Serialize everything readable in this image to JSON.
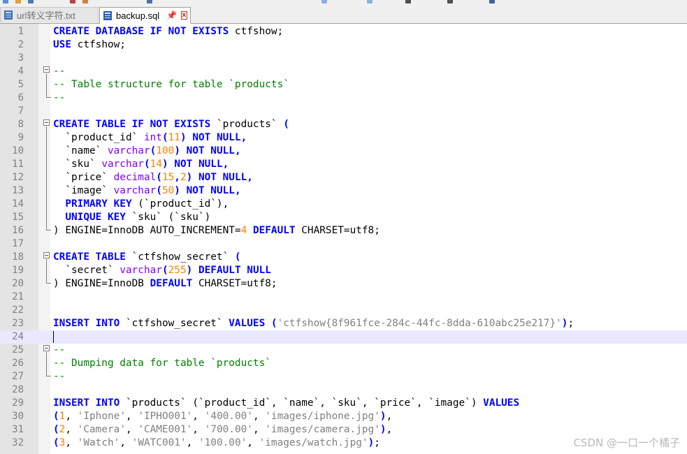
{
  "tabs": [
    {
      "label": "url转义字符.txt",
      "active": false
    },
    {
      "label": "backup.sql",
      "active": true,
      "pin": "📌",
      "close": "x"
    }
  ],
  "watermark": "CSDN @一口一个橘子",
  "current_line": 24,
  "colors": {
    "keyword": "#0000ff",
    "type": "#8000ff",
    "number": "#ff8000",
    "string": "#808080",
    "comment": "#008000"
  },
  "lines": [
    {
      "n": "1",
      "t": [
        [
          "k",
          "CREATE DATABASE IF NOT EXISTS"
        ],
        [
          "x",
          " ctfshow;"
        ]
      ]
    },
    {
      "n": "2",
      "t": [
        [
          "k",
          "USE"
        ],
        [
          "x",
          " ctfshow;"
        ]
      ]
    },
    {
      "n": "3",
      "t": []
    },
    {
      "n": "4",
      "t": [
        [
          "c",
          "--"
        ]
      ]
    },
    {
      "n": "5",
      "t": [
        [
          "c",
          "-- Table structure for table `products`"
        ]
      ]
    },
    {
      "n": "6",
      "t": [
        [
          "c",
          "--"
        ]
      ]
    },
    {
      "n": "7",
      "t": []
    },
    {
      "n": "8",
      "t": [
        [
          "k",
          "CREATE TABLE IF NOT EXISTS"
        ],
        [
          "x",
          " `products` "
        ],
        [
          "k",
          "("
        ]
      ]
    },
    {
      "n": "9",
      "t": [
        [
          "x",
          "  `product_id` "
        ],
        [
          "y",
          "int"
        ],
        [
          "k",
          "("
        ],
        [
          "n",
          "11"
        ],
        [
          "k",
          ")"
        ],
        [
          "x",
          " "
        ],
        [
          "k",
          "NOT NULL,"
        ]
      ]
    },
    {
      "n": "10",
      "t": [
        [
          "x",
          "  `name` "
        ],
        [
          "y",
          "varchar"
        ],
        [
          "k",
          "("
        ],
        [
          "n",
          "100"
        ],
        [
          "k",
          ")"
        ],
        [
          "x",
          " "
        ],
        [
          "k",
          "NOT NULL,"
        ]
      ]
    },
    {
      "n": "11",
      "t": [
        [
          "x",
          "  `sku` "
        ],
        [
          "y",
          "varchar"
        ],
        [
          "k",
          "("
        ],
        [
          "n",
          "14"
        ],
        [
          "k",
          ")"
        ],
        [
          "x",
          " "
        ],
        [
          "k",
          "NOT NULL,"
        ]
      ]
    },
    {
      "n": "12",
      "t": [
        [
          "x",
          "  `price` "
        ],
        [
          "y",
          "decimal"
        ],
        [
          "k",
          "("
        ],
        [
          "n",
          "15"
        ],
        [
          "k",
          ","
        ],
        [
          "n",
          "2"
        ],
        [
          "k",
          ")"
        ],
        [
          "x",
          " "
        ],
        [
          "k",
          "NOT NULL,"
        ]
      ]
    },
    {
      "n": "13",
      "t": [
        [
          "x",
          "  `image` "
        ],
        [
          "y",
          "varchar"
        ],
        [
          "k",
          "("
        ],
        [
          "n",
          "50"
        ],
        [
          "k",
          ")"
        ],
        [
          "x",
          " "
        ],
        [
          "k",
          "NOT NULL,"
        ]
      ]
    },
    {
      "n": "14",
      "t": [
        [
          "x",
          "  "
        ],
        [
          "k",
          "PRIMARY KEY"
        ],
        [
          "x",
          " (`product_id`),"
        ]
      ]
    },
    {
      "n": "15",
      "t": [
        [
          "x",
          "  "
        ],
        [
          "k",
          "UNIQUE KEY"
        ],
        [
          "x",
          " `sku` (`sku`)"
        ]
      ]
    },
    {
      "n": "16",
      "t": [
        [
          "x",
          ") ENGINE=InnoDB AUTO_INCREMENT="
        ],
        [
          "n",
          "4"
        ],
        [
          "x",
          " "
        ],
        [
          "k",
          "DEFAULT"
        ],
        [
          "x",
          " CHARSET=utf8;"
        ]
      ]
    },
    {
      "n": "17",
      "t": []
    },
    {
      "n": "18",
      "t": [
        [
          "k",
          "CREATE TABLE"
        ],
        [
          "x",
          " `ctfshow_secret` "
        ],
        [
          "k",
          "("
        ]
      ]
    },
    {
      "n": "19",
      "t": [
        [
          "x",
          "  `secret` "
        ],
        [
          "y",
          "varchar"
        ],
        [
          "k",
          "("
        ],
        [
          "n",
          "255"
        ],
        [
          "k",
          ")"
        ],
        [
          "x",
          " "
        ],
        [
          "k",
          "DEFAULT NULL"
        ]
      ]
    },
    {
      "n": "20",
      "t": [
        [
          "x",
          ") ENGINE=InnoDB "
        ],
        [
          "k",
          "DEFAULT"
        ],
        [
          "x",
          " CHARSET=utf8;"
        ]
      ]
    },
    {
      "n": "21",
      "t": []
    },
    {
      "n": "22",
      "t": []
    },
    {
      "n": "23",
      "t": [
        [
          "k",
          "INSERT INTO"
        ],
        [
          "x",
          " `ctfshow_secret` "
        ],
        [
          "k",
          "VALUES"
        ],
        [
          "x",
          " "
        ],
        [
          "k",
          "("
        ],
        [
          "s",
          "'ctfshow{8f961fce-284c-44fc-8dda-610abc25e217}'"
        ],
        [
          "k",
          ")"
        ],
        [
          "x",
          ";"
        ]
      ]
    },
    {
      "n": "24",
      "t": []
    },
    {
      "n": "25",
      "t": [
        [
          "c",
          "--"
        ]
      ]
    },
    {
      "n": "26",
      "t": [
        [
          "c",
          "-- Dumping data for table `products`"
        ]
      ]
    },
    {
      "n": "27",
      "t": [
        [
          "c",
          "--"
        ]
      ]
    },
    {
      "n": "28",
      "t": []
    },
    {
      "n": "29",
      "t": [
        [
          "k",
          "INSERT INTO"
        ],
        [
          "x",
          " `products` (`product_id`, `name`, `sku`, `price`, `image`) "
        ],
        [
          "k",
          "VALUES"
        ]
      ]
    },
    {
      "n": "30",
      "t": [
        [
          "k",
          "("
        ],
        [
          "n",
          "1"
        ],
        [
          "x",
          ", "
        ],
        [
          "s",
          "'Iphone'"
        ],
        [
          "x",
          ", "
        ],
        [
          "s",
          "'IPHO001'"
        ],
        [
          "x",
          ", "
        ],
        [
          "s",
          "'400.00'"
        ],
        [
          "x",
          ", "
        ],
        [
          "s",
          "'images/iphone.jpg'"
        ],
        [
          "k",
          ")"
        ],
        [
          "x",
          ","
        ]
      ]
    },
    {
      "n": "31",
      "t": [
        [
          "k",
          "("
        ],
        [
          "n",
          "2"
        ],
        [
          "x",
          ", "
        ],
        [
          "s",
          "'Camera'"
        ],
        [
          "x",
          ", "
        ],
        [
          "s",
          "'CAME001'"
        ],
        [
          "x",
          ", "
        ],
        [
          "s",
          "'700.00'"
        ],
        [
          "x",
          ", "
        ],
        [
          "s",
          "'images/camera.jpg'"
        ],
        [
          "k",
          ")"
        ],
        [
          "x",
          ","
        ]
      ]
    },
    {
      "n": "32",
      "t": [
        [
          "k",
          "("
        ],
        [
          "n",
          "3"
        ],
        [
          "x",
          ", "
        ],
        [
          "s",
          "'Watch'"
        ],
        [
          "x",
          ", "
        ],
        [
          "s",
          "'WATC001'"
        ],
        [
          "x",
          ", "
        ],
        [
          "s",
          "'100.00'"
        ],
        [
          "x",
          ", "
        ],
        [
          "s",
          "'images/watch.jpg'"
        ],
        [
          "k",
          ")"
        ],
        [
          "x",
          ";"
        ]
      ]
    }
  ]
}
